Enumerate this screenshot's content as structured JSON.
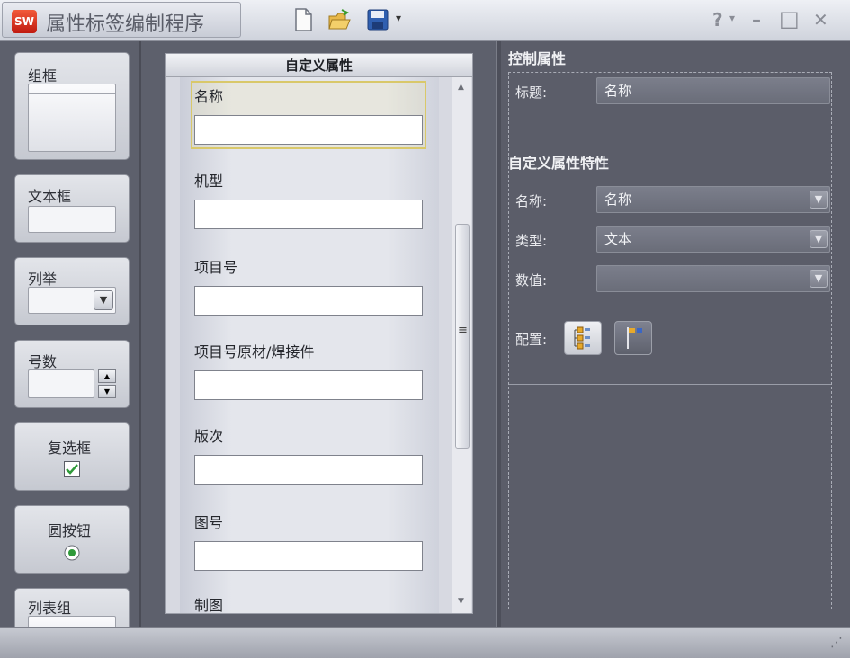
{
  "window": {
    "logo_text": "SW",
    "title": "属性标签编制程序",
    "help_label": "?",
    "help_caret": "▾",
    "minimize_label": "–",
    "maximize_label": "□",
    "close_label": "✕"
  },
  "palette": {
    "groupbox_label": "组框",
    "textbox_label": "文本框",
    "list_label": "列举",
    "number_label": "号数",
    "checkbox_label": "复选框",
    "radio_label": "圆按钮",
    "listgroup_label": "列表组"
  },
  "form": {
    "header": "自定义属性",
    "fields": [
      {
        "label": "名称",
        "value": ""
      },
      {
        "label": "机型",
        "value": ""
      },
      {
        "label": "项目号",
        "value": ""
      },
      {
        "label": "项目号原材/焊接件",
        "value": ""
      },
      {
        "label": "版次",
        "value": ""
      },
      {
        "label": "图号",
        "value": ""
      },
      {
        "label": "制图",
        "value": ""
      }
    ],
    "scroll_grip": "≡"
  },
  "properties": {
    "control_title": "控制属性",
    "caption_label": "标题:",
    "caption_value": "名称",
    "custom_title": "自定义属性特性",
    "name_label": "名称:",
    "name_value": "名称",
    "type_label": "类型:",
    "type_value": "文本",
    "value_label": "数值:",
    "value_value": "",
    "config_label": "配置:"
  },
  "status": {
    "grip": "⋰"
  }
}
